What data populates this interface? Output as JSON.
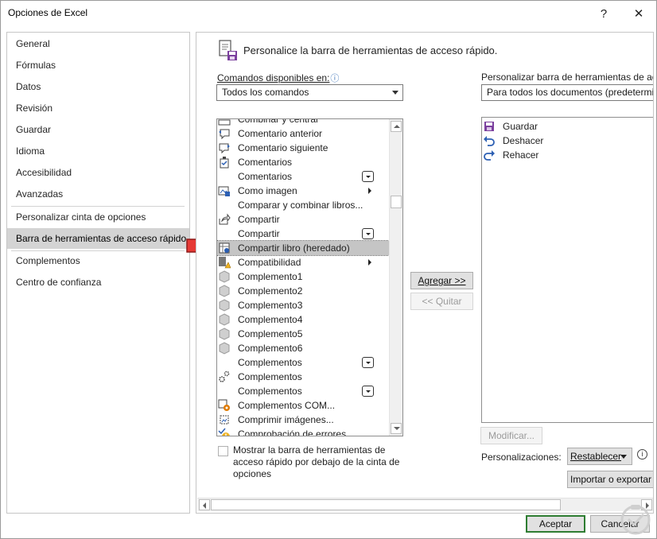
{
  "window": {
    "title": "Opciones de Excel",
    "help_glyph": "?",
    "close_glyph": "✕"
  },
  "nav": {
    "items": [
      {
        "label": "General"
      },
      {
        "label": "Fórmulas"
      },
      {
        "label": "Datos"
      },
      {
        "label": "Revisión"
      },
      {
        "label": "Guardar"
      },
      {
        "label": "Idioma"
      },
      {
        "label": "Accesibilidad"
      },
      {
        "label": "Avanzadas"
      },
      {
        "label": "Personalizar cinta de opciones"
      },
      {
        "label": "Barra de herramientas de acceso rápido",
        "selected": true
      },
      {
        "label": "Complementos"
      },
      {
        "label": "Centro de confianza"
      }
    ]
  },
  "header": {
    "title": "Personalice la barra de herramientas de acceso rápido."
  },
  "commands": {
    "label": "Comandos disponibles en:",
    "info_glyph": "ⓘ",
    "dropdown_value": "Todos los comandos",
    "partial_item": "Combinar y centrar",
    "items": [
      {
        "label": "Comentario anterior",
        "icon": "comment-prev-icon"
      },
      {
        "label": "Comentario siguiente",
        "icon": "comment-next-icon"
      },
      {
        "label": "Comentarios",
        "icon": "comments-check-icon"
      },
      {
        "label": "Comentarios",
        "icon": "",
        "indicator": "dropdown"
      },
      {
        "label": "Como imagen",
        "icon": "picture-icon",
        "indicator": "submenu"
      },
      {
        "label": "Comparar y combinar libros...",
        "icon": ""
      },
      {
        "label": "Compartir",
        "icon": "share-icon"
      },
      {
        "label": "Compartir",
        "icon": "",
        "indicator": "dropdown"
      },
      {
        "label": "Compartir libro (heredado)",
        "icon": "share-workbook-icon",
        "selected": true
      },
      {
        "label": "Compatibilidad",
        "icon": "compatibility-icon",
        "indicator": "submenu"
      },
      {
        "label": "Complemento1",
        "icon": "addin-icon"
      },
      {
        "label": "Complemento2",
        "icon": "addin-icon"
      },
      {
        "label": "Complemento3",
        "icon": "addin-icon"
      },
      {
        "label": "Complemento4",
        "icon": "addin-icon"
      },
      {
        "label": "Complemento5",
        "icon": "addin-icon"
      },
      {
        "label": "Complemento6",
        "icon": "addin-icon"
      },
      {
        "label": "Complementos",
        "icon": "",
        "indicator": "dropdown"
      },
      {
        "label": "Complementos",
        "icon": "gears-icon"
      },
      {
        "label": "Complementos",
        "icon": "",
        "indicator": "dropdown"
      },
      {
        "label": "Complementos COM...",
        "icon": "com-addins-icon"
      },
      {
        "label": "Comprimir imágenes...",
        "icon": "compress-icon"
      },
      {
        "label": "Comprobación de errores...",
        "icon": "error-check-icon"
      }
    ]
  },
  "customize": {
    "label": "Personalizar barra de herramientas de acceso rápido:",
    "dropdown_value": "Para todos los documentos (predeterminado)",
    "items": [
      {
        "label": "Guardar",
        "icon": "save-icon"
      },
      {
        "label": "Deshacer",
        "icon": "undo-icon"
      },
      {
        "label": "Rehacer",
        "icon": "redo-icon"
      }
    ]
  },
  "buttons": {
    "add": "Agregar >>",
    "remove": "<< Quitar",
    "modify": "Modificar...",
    "reset": "Restablecer",
    "import_export": "Importar o exportar",
    "ok": "Aceptar",
    "cancel": "Cancelar"
  },
  "checkbox": {
    "label": "Mostrar la barra de herramientas de acceso rápido por debajo de la cinta de opciones",
    "checked": false
  },
  "customizations_label": "Personalizaciones:",
  "colors": {
    "accent_green": "#2e7d32",
    "selected_nav": "#d4d4d4",
    "arrow_red": "#e53935",
    "save_purple": "#7b3f9e",
    "undo_blue": "#2c5fb3"
  }
}
